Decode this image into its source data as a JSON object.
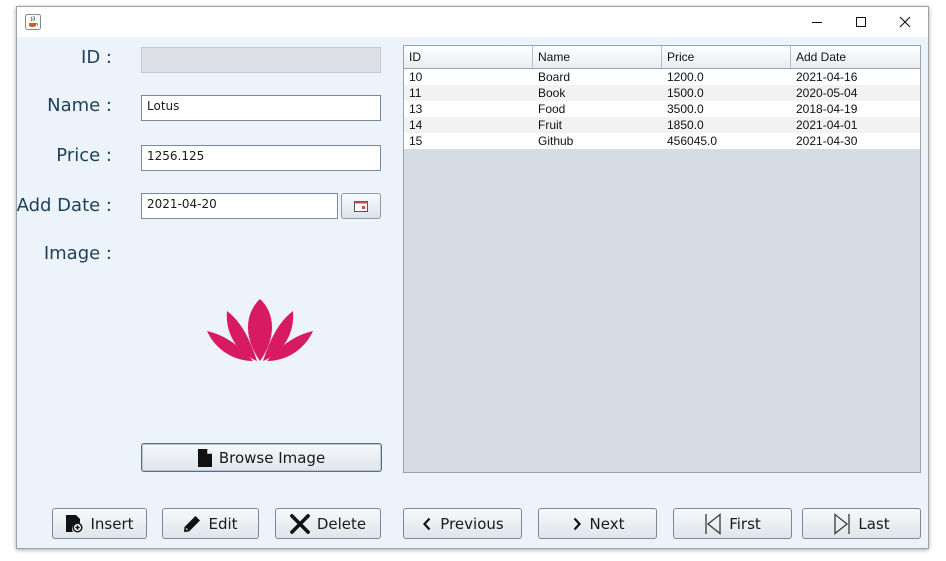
{
  "window": {
    "app_icon": "java-cup-icon",
    "controls": {
      "minimize": "minimize-icon",
      "maximize": "maximize-icon",
      "close": "close-icon"
    }
  },
  "form": {
    "id_label": "ID :",
    "id_value": "",
    "name_label": "Name :",
    "name_value": "Lotus",
    "price_label": "Price :",
    "price_value": "1256.125",
    "date_label": "Add Date :",
    "date_value": "2021-04-20",
    "calendar_icon": "calendar-icon",
    "image_label": "Image :",
    "image_icon": "lotus-flower-image",
    "browse_label": "Browse Image",
    "browse_icon": "file-icon"
  },
  "table": {
    "columns": [
      "ID",
      "Name",
      "Price",
      "Add Date"
    ],
    "rows": [
      [
        "10",
        "Board",
        "1200.0",
        "2021-04-16"
      ],
      [
        "11",
        "Book",
        "1500.0",
        "2020-05-04"
      ],
      [
        "13",
        "Food",
        "3500.0",
        "2018-04-19"
      ],
      [
        "14",
        "Fruit",
        "1850.0",
        "2021-04-01"
      ],
      [
        "15",
        "Github",
        "456045.0",
        "2021-04-30"
      ]
    ]
  },
  "actions": {
    "insert": "Insert",
    "edit": "Edit",
    "delete": "Delete",
    "previous": "Previous",
    "next": "Next",
    "first": "First",
    "last": "Last"
  },
  "colors": {
    "label_text": "#1f4059",
    "window_bg": "#ecf3fb",
    "lotus": "#d81b60"
  }
}
